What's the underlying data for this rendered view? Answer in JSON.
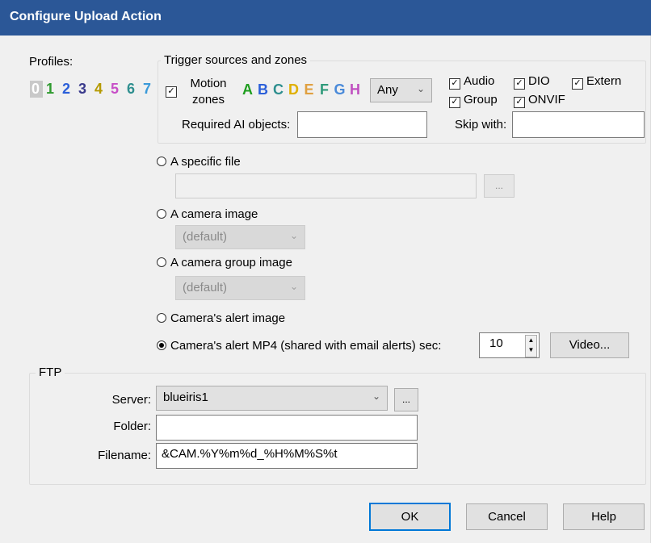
{
  "window": {
    "title": "Configure Upload Action"
  },
  "profiles": {
    "label": "Profiles:",
    "items": [
      {
        "text": "0",
        "color": "#ffffff"
      },
      {
        "text": "1",
        "color": "#2e9a2e"
      },
      {
        "text": "2",
        "color": "#2b5fd9"
      },
      {
        "text": "3",
        "color": "#3a3a8c"
      },
      {
        "text": "4",
        "color": "#b59a00"
      },
      {
        "text": "5",
        "color": "#c74fc7"
      },
      {
        "text": "6",
        "color": "#2e8f8f"
      },
      {
        "text": "7",
        "color": "#3a9ad9"
      }
    ]
  },
  "trigger": {
    "group_title": "Trigger sources and zones",
    "motion_label_1": "Motion",
    "motion_label_2": "zones",
    "zones": [
      {
        "text": "A",
        "color": "#1f9e1f"
      },
      {
        "text": "B",
        "color": "#2b5fd9"
      },
      {
        "text": "C",
        "color": "#2e8f8f"
      },
      {
        "text": "D",
        "color": "#e0b000"
      },
      {
        "text": "E",
        "color": "#e0a040"
      },
      {
        "text": "F",
        "color": "#2e9a7a"
      },
      {
        "text": "G",
        "color": "#4a8ad9"
      },
      {
        "text": "H",
        "color": "#c050c0"
      }
    ],
    "mode_select": "Any",
    "checks": {
      "audio": "Audio",
      "dio": "DIO",
      "extern": "Extern",
      "group": "Group",
      "onvif": "ONVIF"
    },
    "required_ai_label": "Required AI objects:",
    "required_ai_value": "",
    "skip_with_label": "Skip with:",
    "skip_with_value": ""
  },
  "source": {
    "specific_file_label": "A specific file",
    "specific_file_value": "",
    "browse_label": "...",
    "camera_image_label": "A camera image",
    "camera_image_select": "(default)",
    "camera_group_label": "A camera group image",
    "camera_group_select": "(default)",
    "alert_image_label": "Camera's alert image",
    "alert_mp4_label": "Camera's alert MP4 (shared with email alerts) sec:",
    "alert_mp4_seconds": "10",
    "video_button": "Video..."
  },
  "ftp": {
    "group_title": "FTP",
    "server_label": "Server:",
    "server_value": "blueiris1",
    "server_more": "...",
    "folder_label": "Folder:",
    "folder_value": "",
    "filename_label": "Filename:",
    "filename_value": "&CAM.%Y%m%d_%H%M%S%t"
  },
  "buttons": {
    "ok": "OK",
    "cancel": "Cancel",
    "help": "Help"
  }
}
